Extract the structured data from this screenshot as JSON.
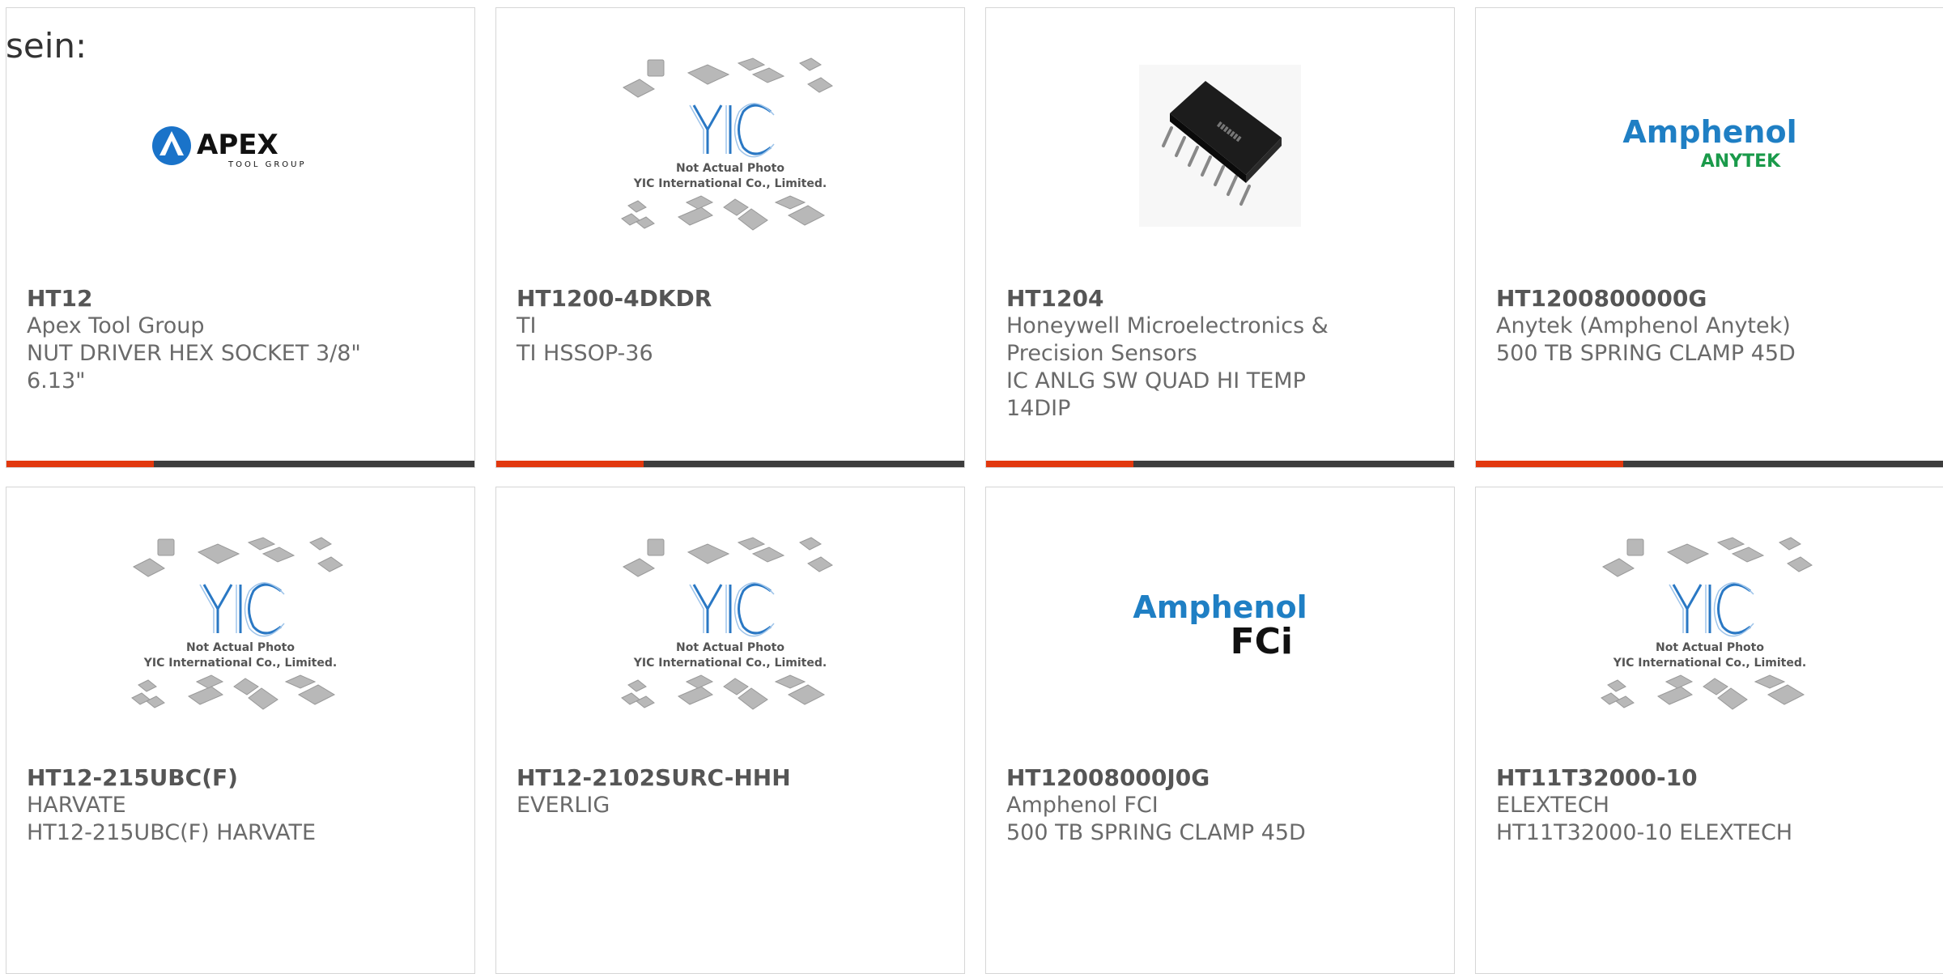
{
  "heading": "sein:",
  "placeholder": {
    "line1": "Not Actual Photo",
    "line2": "YIC International Co., Limited."
  },
  "logos": {
    "apex": {
      "main": "APEX",
      "sub": "TOOL GROUP"
    },
    "amphenol_anytek": {
      "main": "Amphenol",
      "sub": "ANYTEK"
    },
    "amphenol_fci": {
      "main": "Amphenol",
      "sub": "FCi"
    }
  },
  "products": [
    {
      "part": "HT12",
      "maker": "Apex Tool Group",
      "desc": "NUT DRIVER HEX SOCKET 3/8\" 6.13\"",
      "image": "apex-logo"
    },
    {
      "part": "HT1200-4DKDR",
      "maker": "TI",
      "desc": "TI HSSOP-36",
      "image": "yic-placeholder"
    },
    {
      "part": "HT1204",
      "maker": "Honeywell Microelectronics & Precision Sensors",
      "desc": "IC ANLG SW QUAD HI TEMP 14DIP",
      "image": "dip-chip-photo"
    },
    {
      "part": "HT1200800000G",
      "maker": "Anytek (Amphenol Anytek)",
      "desc": "500 TB SPRING CLAMP 45D",
      "image": "amphenol-anytek-logo"
    },
    {
      "part": "HT12-215UBC(F)",
      "maker": "HARVATE",
      "desc": "HT12-215UBC(F) HARVATE",
      "image": "yic-placeholder"
    },
    {
      "part": "HT12-2102SURC-HHH",
      "maker": "EVERLIG",
      "desc": "",
      "image": "yic-placeholder"
    },
    {
      "part": "HT12008000J0G",
      "maker": "Amphenol FCI",
      "desc": "500 TB SPRING CLAMP 45D",
      "image": "amphenol-fci-logo"
    },
    {
      "part": "HT11T32000-10",
      "maker": "ELEXTECH",
      "desc": "HT11T32000-10 ELEXTECH",
      "image": "yic-placeholder"
    }
  ],
  "colors": {
    "accent": "#e2380e",
    "bar": "#3d3d3d",
    "yic_blue": "#2a78c4"
  }
}
